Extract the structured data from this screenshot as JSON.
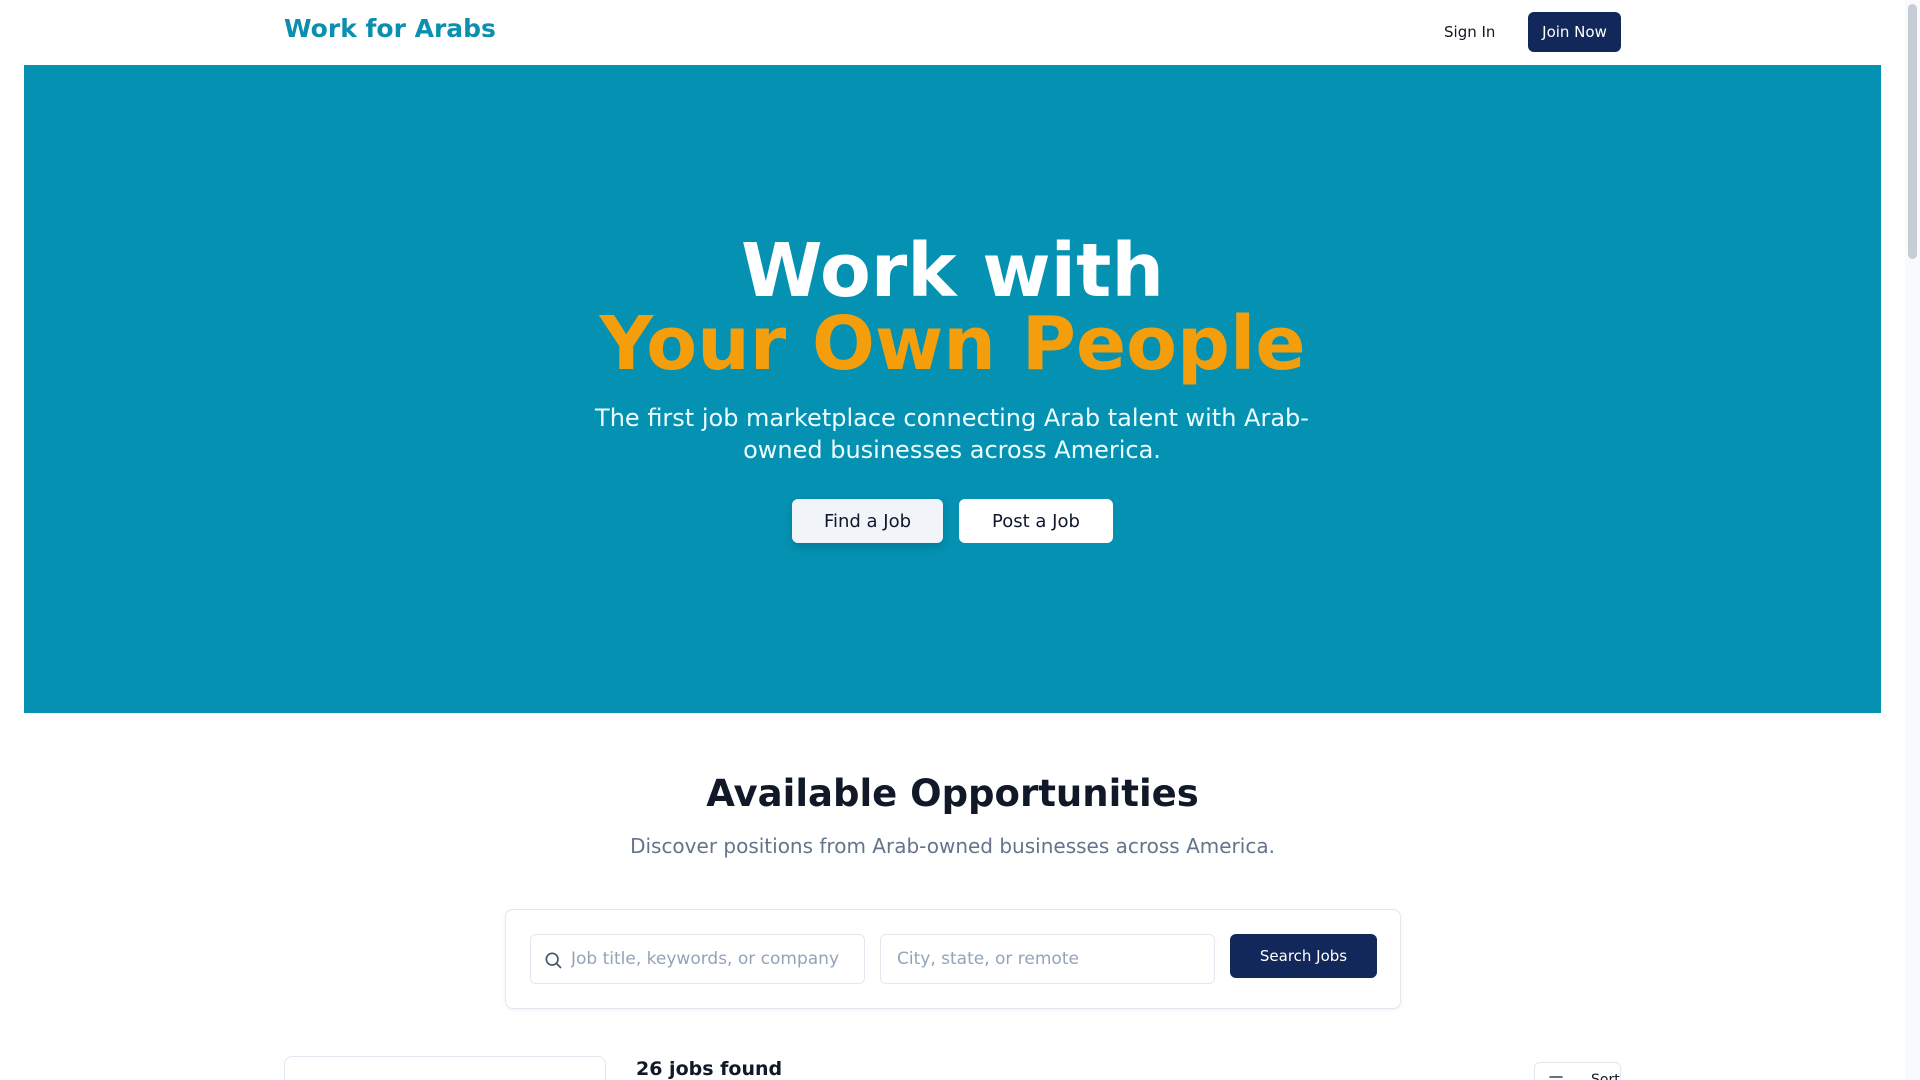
{
  "header": {
    "logo": "Work for Arabs",
    "sign_in": "Sign In",
    "join_now": "Join Now"
  },
  "hero": {
    "title_line1": "Work with",
    "title_line2": "Your Own People",
    "subtitle": "The first job marketplace connecting Arab talent with Arab-owned businesses across America.",
    "find_job": "Find a Job",
    "post_job": "Post a Job"
  },
  "opportunities": {
    "title": "Available Opportunities",
    "subtitle": "Discover positions from Arab-owned businesses across America.",
    "search": {
      "keyword_placeholder": "Job title, keywords, or company",
      "location_placeholder": "City, state, or remote",
      "button": "Search Jobs"
    },
    "results_count": "26 jobs found",
    "sort_label": "Sort"
  },
  "icons": {
    "search": "search-icon",
    "sort": "sliders-icon"
  },
  "colors": {
    "brand": "#0a8fae",
    "hero_bg": "#0491b2",
    "accent": "#f59e0b",
    "navy": "#12275a"
  }
}
